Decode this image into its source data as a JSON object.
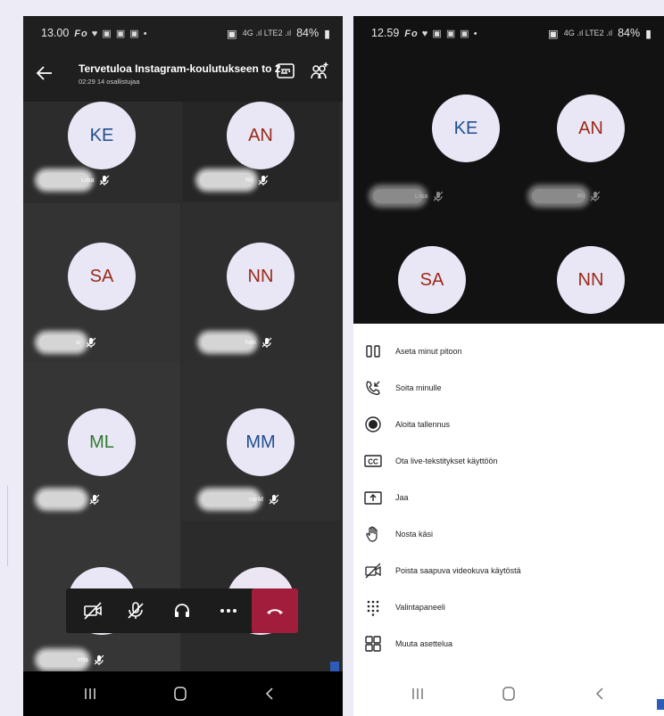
{
  "screenA": {
    "status": {
      "time": "13.00",
      "battery": "84%"
    },
    "meeting": {
      "title": "Tervetuloa Instagram-koulutukseen to 2…",
      "subtitle": "02:29 14 osallistujaa"
    },
    "participants": [
      {
        "initials": "KE",
        "color": "#1f4f8f",
        "name_fragment": "Liisa"
      },
      {
        "initials": "AN",
        "color": "#9a2a17",
        "name_fragment": "Rii"
      },
      {
        "initials": "SA",
        "color": "#9a2a17",
        "name_fragment": "si"
      },
      {
        "initials": "NN",
        "color": "#9a2a17",
        "name_fragment": "han"
      },
      {
        "initials": "ML",
        "color": "#2f7a2f",
        "name_fragment": ""
      },
      {
        "initials": "MM",
        "color": "#1f4f8f",
        "name_fragment": "na-M"
      },
      {
        "initials": "",
        "color": "#9a2a17",
        "name_fragment": "etta"
      }
    ],
    "toolbar_icons": [
      "camera-off-icon",
      "mic-off-icon",
      "headset-icon",
      "more-icon",
      "hang-up-icon"
    ]
  },
  "screenB": {
    "status": {
      "time": "12.59",
      "battery": "84%"
    },
    "participants": [
      {
        "initials": "KE",
        "color": "#1f4f8f",
        "name_fragment": "Liisa"
      },
      {
        "initials": "AN",
        "color": "#9a2a17",
        "name_fragment": "Rii"
      },
      {
        "initials": "SA",
        "color": "#9a2a17"
      },
      {
        "initials": "NN",
        "color": "#9a2a17"
      }
    ],
    "menu": [
      {
        "icon": "hold-icon",
        "label": "Aseta minut pitoon"
      },
      {
        "icon": "phone-callback-icon",
        "label": "Soita minulle"
      },
      {
        "icon": "record-icon",
        "label": "Aloita tallennus"
      },
      {
        "icon": "closed-captions-icon",
        "label": "Ota live-tekstitykset käyttöön"
      },
      {
        "icon": "share-icon",
        "label": "Jaa"
      },
      {
        "icon": "raise-hand-icon",
        "label": "Nosta käsi"
      },
      {
        "icon": "video-off-icon",
        "label": "Poista saapuva videokuva käytöstä"
      },
      {
        "icon": "dialpad-icon",
        "label": "Valintapaneeli"
      },
      {
        "icon": "layout-icon",
        "label": "Muuta asettelua"
      }
    ]
  }
}
